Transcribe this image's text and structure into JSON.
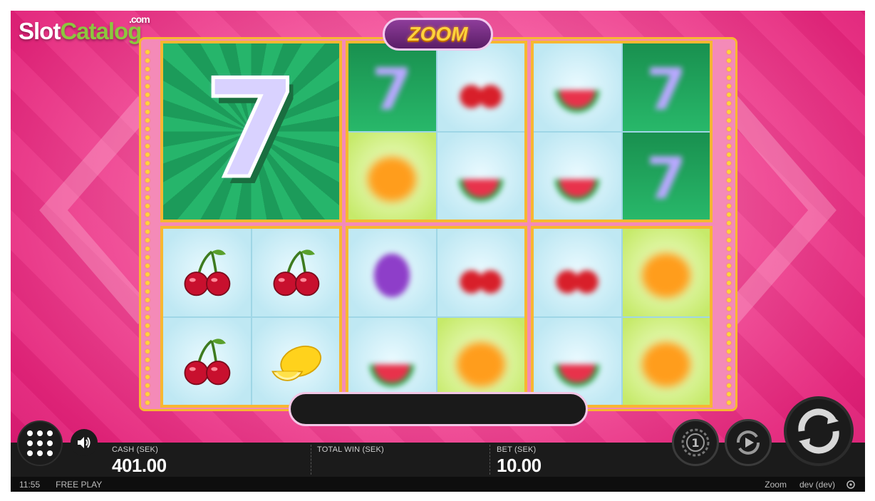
{
  "branding": {
    "slot": "Slot",
    "catalog": "Catalog",
    "com": ".com"
  },
  "game": {
    "title": "ZOOM"
  },
  "message_bar": {
    "text": ""
  },
  "stats": {
    "cash_label": "CASH (SEK)",
    "cash_value": "401.00",
    "total_win_label": "TOTAL WIN (SEK)",
    "total_win_value": "",
    "bet_label": "BET (SEK)",
    "bet_value": "10.00"
  },
  "status_bar": {
    "time": "11:55",
    "mode": "FREE PLAY",
    "game_name": "Zoom",
    "user": "dev (dev)"
  },
  "icons": {
    "menu": "menu-grid-icon",
    "sound": "speaker-icon",
    "coin": "coin-bet-icon",
    "autoplay": "autoplay-icon",
    "spin": "spin-icon",
    "help": "help-icon"
  },
  "reels": {
    "top_left": "big-seven",
    "bottom_left": [
      "cherry",
      "cherry",
      "cherry",
      "lemon"
    ]
  },
  "colors": {
    "frame_gold": "#f7b731",
    "background_pink": "#e4237a",
    "zoom_text": "#ffd23c",
    "brand_green": "#8cc63f"
  }
}
